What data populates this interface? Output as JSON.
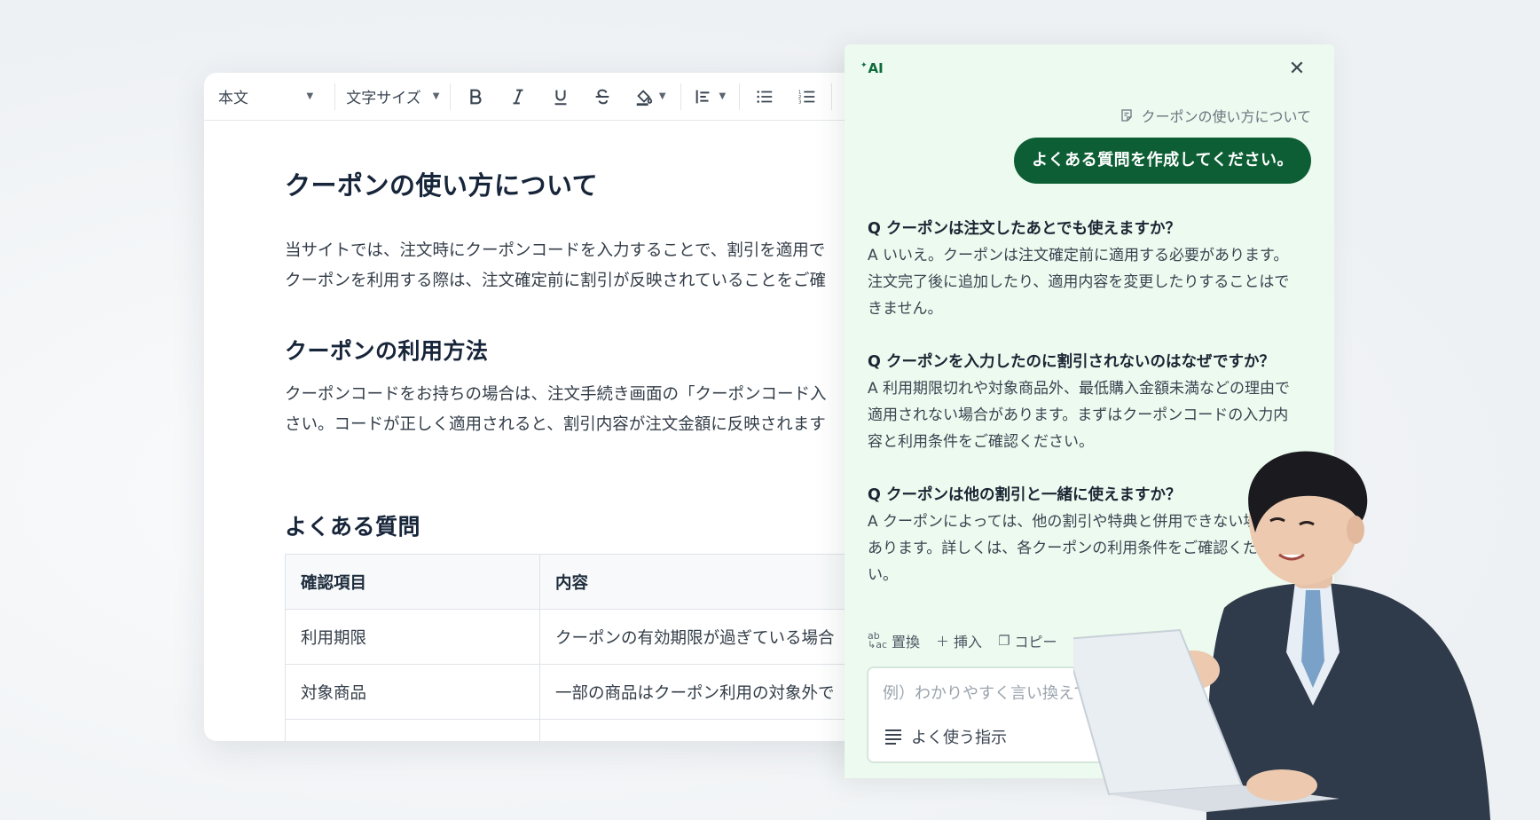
{
  "toolbar": {
    "paragraph_style": "本文",
    "font_size": "文字サイズ"
  },
  "document": {
    "title": "クーポンの使い方について",
    "intro_line1": "当サイトでは、注文時にクーポンコードを入力することで、割引を適用で",
    "intro_line2": "クーポンを利用する際は、注文確定前に割引が反映されていることをご確",
    "section2_heading": "クーポンの利用方法",
    "section2_line1": "クーポンコードをお持ちの場合は、注文手続き画面の「クーポンコード入",
    "section2_line2": "さい。コードが正しく適用されると、割引内容が注文金額に反映されます",
    "section3_heading": "よくある質問",
    "table": {
      "headers": [
        "確認項目",
        "内容"
      ],
      "rows": [
        [
          "利用期限",
          "クーポンの有効期限が過ぎている場合"
        ],
        [
          "対象商品",
          "一部の商品はクーポン利用の対象外で"
        ],
        [
          "",
          ""
        ]
      ]
    }
  },
  "ai_panel": {
    "logo": "AI",
    "context_label": "クーポンの使い方について",
    "user_message": "よくある質問を作成してください。",
    "qa": [
      {
        "q": "Q クーポンは注文したあとでも使えますか？",
        "a_lines": [
          "A いいえ。クーポンは注文確定前に適用する必要があります。",
          "注文完了後に追加したり、適用内容を変更したりすることはで",
          "きません。"
        ]
      },
      {
        "q": "Q クーポンを入力したのに割引されないのはなぜですか？",
        "a_lines": [
          "A 利用期限切れや対象商品外、最低購入金額未満などの理由で",
          "適用されない場合があります。まずはクーポンコードの入力内",
          "容と利用条件をご確認ください。"
        ]
      },
      {
        "q": "Q クーポンは他の割引と一緒に使えますか？",
        "a_lines": [
          "A クーポンによっては、他の割引や特典と併用できない場合が",
          "あります。詳しくは、各クーポンの利用条件をご確認くださ",
          "い。"
        ]
      }
    ],
    "actions": {
      "replace_icon_top": "ab",
      "replace_icon_bottom": "↳ac",
      "replace": "置換",
      "insert": "挿入",
      "copy": "コピー"
    },
    "input_placeholder": "例）わかりやすく言い換えて",
    "frequent_instructions": "よく使う指示"
  },
  "colors": {
    "accent_green": "#0d5e35",
    "panel_bg": "#ecfaef"
  }
}
